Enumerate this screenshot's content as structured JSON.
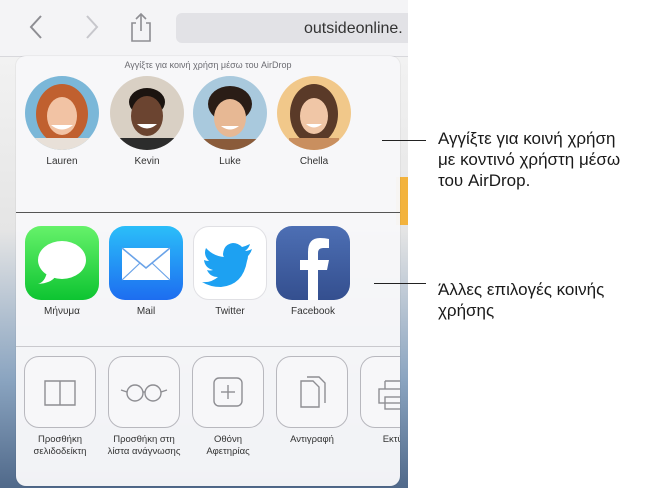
{
  "browser": {
    "url_text": "outsideonline."
  },
  "share_sheet": {
    "airdrop_hint": "Αγγίξτε για κοινή χρήση μέσω του AirDrop",
    "people": [
      {
        "name": "Lauren"
      },
      {
        "name": "Kevin"
      },
      {
        "name": "Luke"
      },
      {
        "name": "Chella"
      }
    ],
    "apps": [
      {
        "label": "Μήνυμα",
        "icon": "messages-icon"
      },
      {
        "label": "Mail",
        "icon": "mail-icon"
      },
      {
        "label": "Twitter",
        "icon": "twitter-icon"
      },
      {
        "label": "Facebook",
        "icon": "facebook-icon"
      }
    ],
    "actions": [
      {
        "label": "Προσθήκη\nσελιδοδείκτη",
        "icon": "bookmark-book-icon"
      },
      {
        "label": "Προσθήκη στη\nλίστα ανάγνωσης",
        "icon": "reading-glasses-icon"
      },
      {
        "label": "Οθόνη\nΑφετηρίας",
        "icon": "add-plus-icon"
      },
      {
        "label": "Αντιγραφή",
        "icon": "copy-documents-icon"
      },
      {
        "label": "Εκτύπ",
        "icon": "print-icon"
      }
    ]
  },
  "callouts": {
    "airdrop": "Αγγίξτε για κοινή χρήση\nμε κοντινό χρήστη μέσω\nτου AirDrop.",
    "other_sharing": "Άλλες επιλογές κοινής\nχρήσης"
  },
  "colors": {
    "accent": "#007aff",
    "messages_green": "#0dc431",
    "mail_blue": "#1d6df0",
    "twitter_blue": "#1da1f2",
    "facebook_blue": "#3b5998"
  }
}
